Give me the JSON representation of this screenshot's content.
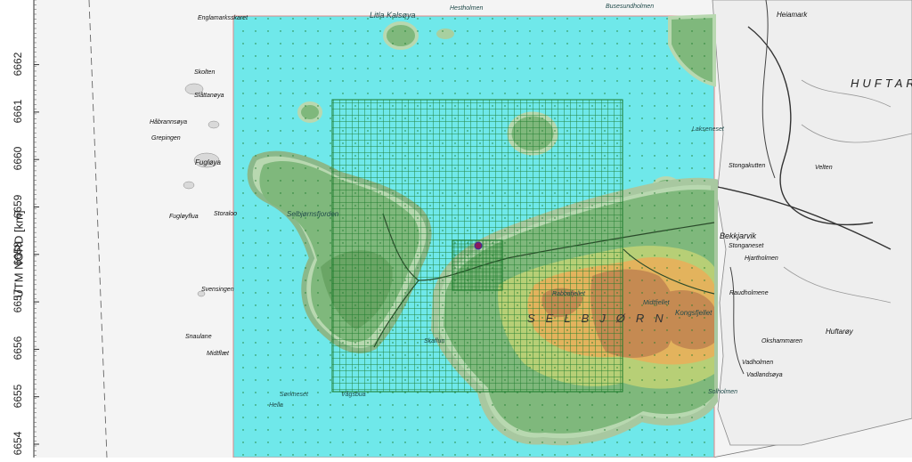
{
  "axis": {
    "y_label": "UTM NORD [km]",
    "y_ticks": [
      "6654",
      "6655",
      "6656",
      "6657",
      "6658",
      "6659",
      "6660",
      "6661",
      "6662"
    ]
  },
  "map": {
    "region_label": "SELBJØRN",
    "region_label_2": "HUFTARØ",
    "basemap_colors": {
      "land": "#efefef",
      "sea": "#ffffff",
      "model_sea": "#6fe8ea"
    },
    "terrain_colors": [
      "#8fc38f",
      "#6fae6a",
      "#b7cf76",
      "#e3b35d",
      "#c58a52"
    ],
    "grid_color": "#1a7a2a",
    "source_marker_color": "#8b1a5c",
    "places": [
      {
        "name": "Litla Kalsøya"
      },
      {
        "name": "Hestholmen"
      },
      {
        "name": "Busesundholmen"
      },
      {
        "name": "Heiamark"
      },
      {
        "name": "Englamarksskaret"
      },
      {
        "name": "Skolten"
      },
      {
        "name": "Slåttanøya"
      },
      {
        "name": "Håbrannsøya"
      },
      {
        "name": "Grepingen"
      },
      {
        "name": "Fugløya"
      },
      {
        "name": "Fugløyflua"
      },
      {
        "name": "Storaloo"
      },
      {
        "name": "Svensingen"
      },
      {
        "name": "Snaulane"
      },
      {
        "name": "Midtflæt"
      },
      {
        "name": "Stongakutten"
      },
      {
        "name": "Velten"
      },
      {
        "name": "Bekkjarvik"
      },
      {
        "name": "Stonganeset"
      },
      {
        "name": "Hjartholmen"
      },
      {
        "name": "Huftarøy"
      },
      {
        "name": "Okshammaren"
      },
      {
        "name": "Vadholmen"
      },
      {
        "name": "Vadlandsøya"
      },
      {
        "name": "Raudholmene"
      },
      {
        "name": "Midtfjellet"
      },
      {
        "name": "Kongsfjellet"
      },
      {
        "name": "Rabbafjellet"
      },
      {
        "name": "Solholmen"
      },
      {
        "name": "Skaflun"
      },
      {
        "name": "Vågsbua"
      },
      {
        "name": "Hella"
      },
      {
        "name": "Sørkneset"
      },
      {
        "name": "Lakseneset"
      },
      {
        "name": "Selbjørnsfjorden"
      }
    ]
  }
}
